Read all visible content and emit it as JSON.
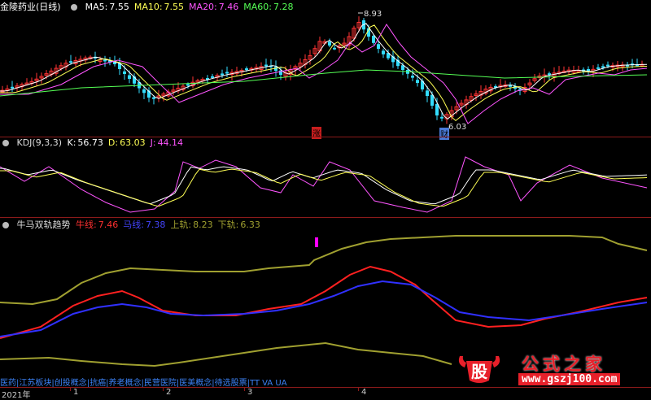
{
  "main": {
    "title": "金陵药业(日线)",
    "indicators": [
      {
        "label": "MA5:",
        "value": "7.55",
        "color": "#ffffff"
      },
      {
        "label": "MA10:",
        "value": "7.55",
        "color": "#ffff55"
      },
      {
        "label": "MA20:",
        "value": "7.46",
        "color": "#ff55ff"
      },
      {
        "label": "MA60:",
        "value": "7.28",
        "color": "#55ff55"
      }
    ],
    "high_label": "8.93",
    "low_label": "6.03",
    "zhang_label": "涨",
    "cai_label": "财"
  },
  "kdj": {
    "title": "KDJ(9,3,3)",
    "items": [
      {
        "label": "K:",
        "value": "56.73",
        "color": "#ffffff"
      },
      {
        "label": "D:",
        "value": "63.03",
        "color": "#ffff55"
      },
      {
        "label": "J:",
        "value": "44.14",
        "color": "#ff55ff"
      }
    ]
  },
  "trend": {
    "title": "牛马双轨趋势",
    "items": [
      {
        "label": "牛线:",
        "value": "7.46",
        "color": "#ff3030"
      },
      {
        "label": "马线:",
        "value": "7.38",
        "color": "#4444ff"
      },
      {
        "label": "上轨:",
        "value": "8.23",
        "color": "#a0a030"
      },
      {
        "label": "下轨:",
        "value": "6.33",
        "color": "#a0a030"
      }
    ]
  },
  "footer_text": "医药|江苏板块|创投概念|抗癌|养老概念|民营医院|医美概念|待选股票|TT VA UA",
  "axis": [
    {
      "label": "2021年"
    },
    {
      "label": "1"
    },
    {
      "label": "2"
    },
    {
      "label": "3"
    },
    {
      "label": "4"
    }
  ],
  "watermark": {
    "logo_char": "股",
    "title": "公式之家",
    "url": "www.gszj100.com"
  },
  "colors": {
    "up": "#ff3333",
    "down": "#33ddff",
    "separator": "#8b1a1a"
  }
}
